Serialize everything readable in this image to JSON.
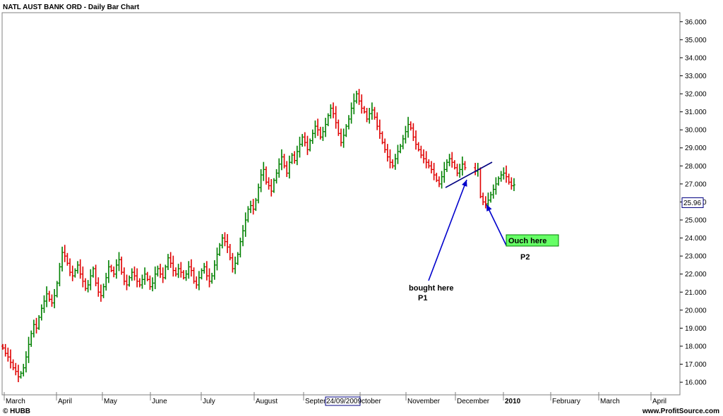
{
  "chart_data": {
    "type": "bar",
    "title": "NATL AUST BANK ORD - Daily Bar Chart",
    "footer_left": "© HUBB",
    "footer_right": "www.ProfitSource.com",
    "y_ticks": [
      "16.000",
      "17.000",
      "18.000",
      "19.000",
      "20.000",
      "21.000",
      "22.000",
      "23.000",
      "24.000",
      "25.000",
      "26.000",
      "27.000",
      "28.000",
      "29.000",
      "30.000",
      "31.000",
      "32.000",
      "33.000",
      "34.000",
      "35.000",
      "36.000"
    ],
    "ylim": [
      15.3,
      36.5
    ],
    "x_labels": [
      {
        "label": "March",
        "bold": false
      },
      {
        "label": "April",
        "bold": false
      },
      {
        "label": "May",
        "bold": false
      },
      {
        "label": "June",
        "bold": false
      },
      {
        "label": "July",
        "bold": false
      },
      {
        "label": "August",
        "bold": false
      },
      {
        "label": "Septem",
        "bold": false
      },
      {
        "label": "ctober",
        "bold": false
      },
      {
        "label": "November",
        "bold": false
      },
      {
        "label": "December",
        "bold": false
      },
      {
        "label": "2010",
        "bold": true
      },
      {
        "label": "February",
        "bold": false
      },
      {
        "label": "March",
        "bold": false
      },
      {
        "label": "April",
        "bold": false
      }
    ],
    "date_box": "24/09/2009",
    "price_box": "25.96",
    "price_box_value": 25.96,
    "colors": {
      "up": "#008000",
      "down": "#e00000",
      "trendline": "#000080",
      "arrow": "#0000cc",
      "highlight": "#66ff66"
    },
    "closes": [
      17.9,
      17.6,
      17.4,
      17.1,
      16.8,
      16.6,
      16.3,
      16.5,
      16.8,
      17.4,
      18.1,
      18.7,
      19.2,
      19.0,
      19.6,
      20.1,
      20.5,
      20.9,
      20.6,
      20.4,
      20.8,
      21.5,
      22.4,
      23.2,
      23.0,
      22.6,
      22.1,
      21.9,
      22.2,
      22.5,
      22.0,
      21.6,
      21.2,
      21.4,
      21.9,
      22.3,
      21.5,
      21.0,
      20.8,
      21.3,
      21.8,
      22.4,
      22.2,
      22.0,
      22.5,
      22.8,
      22.1,
      21.6,
      21.4,
      21.8,
      22.1,
      21.9,
      21.6,
      21.4,
      21.7,
      22.0,
      21.7,
      21.3,
      21.5,
      22.0,
      22.3,
      22.0,
      21.8,
      22.4,
      22.9,
      22.6,
      22.2,
      22.0,
      22.3,
      22.1,
      21.8,
      22.0,
      22.4,
      22.2,
      21.6,
      21.4,
      21.8,
      22.2,
      22.4,
      21.9,
      21.6,
      21.9,
      22.5,
      23.1,
      23.6,
      24.0,
      23.8,
      23.5,
      22.9,
      22.3,
      22.6,
      23.1,
      23.8,
      24.4,
      25.0,
      25.6,
      25.8,
      25.6,
      26.1,
      26.8,
      27.5,
      27.8,
      27.1,
      26.9,
      26.6,
      27.2,
      27.6,
      28.1,
      28.5,
      28.0,
      27.6,
      28.2,
      28.6,
      28.3,
      28.8,
      29.2,
      29.6,
      29.3,
      28.9,
      29.4,
      29.8,
      30.2,
      30.0,
      29.6,
      29.9,
      30.3,
      30.8,
      31.2,
      30.9,
      30.4,
      29.8,
      29.3,
      29.7,
      30.2,
      30.6,
      31.2,
      31.6,
      32.0,
      31.6,
      31.2,
      31.0,
      30.6,
      30.9,
      31.1,
      30.7,
      30.2,
      29.8,
      29.3,
      28.9,
      28.5,
      28.2,
      28.0,
      28.4,
      28.8,
      29.1,
      29.5,
      29.9,
      30.3,
      30.1,
      29.6,
      29.2,
      28.9,
      28.6,
      28.4,
      28.2,
      28.0,
      27.8,
      27.5,
      27.2,
      27.0,
      27.4,
      27.8,
      28.2,
      28.4,
      28.2,
      27.9,
      27.6,
      27.8,
      28.1,
      27.9,
      27.7,
      27.8,
      26.3,
      26.0,
      25.9,
      26.1,
      26.4,
      26.7,
      27.0,
      27.3,
      27.5,
      27.6,
      27.4,
      27.1,
      26.9,
      26.95
    ],
    "gap_after_index": 179,
    "annotations": [
      {
        "text": "bought here",
        "highlight": false
      },
      {
        "text": "P1",
        "highlight": false
      },
      {
        "text": "Ouch here",
        "highlight": true
      },
      {
        "text": "P2",
        "highlight": false
      }
    ]
  }
}
